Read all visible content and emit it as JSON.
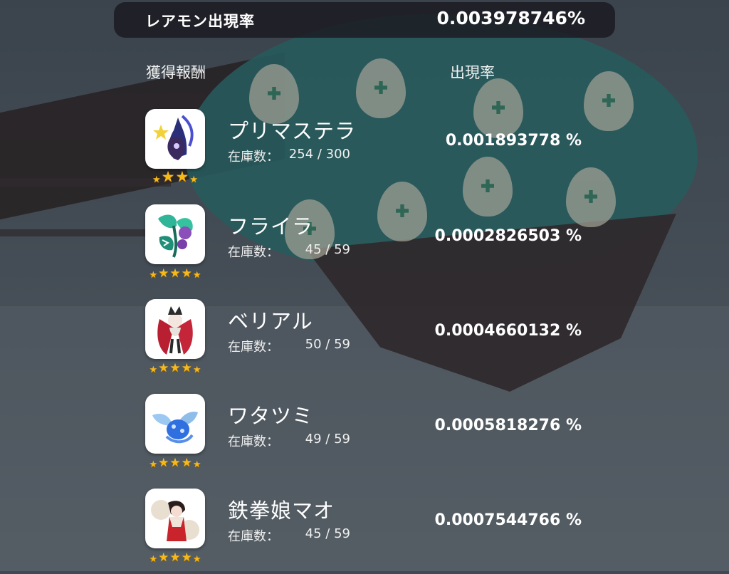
{
  "header": {
    "title": "レアモン出現率",
    "rate": "0.003978746%"
  },
  "columns": {
    "reward": "獲得報酬",
    "rate": "出現率"
  },
  "rewards": [
    {
      "name": "プリマステラ",
      "stock_label": "在庫数：",
      "stock": "254 / 300",
      "rate": "0.001893778 %",
      "stars": 3
    },
    {
      "name": "フライラ",
      "stock_label": "在庫数：",
      "stock": "45 / 59",
      "rate": "0.0002826503 %",
      "stars": 4
    },
    {
      "name": "ベリアル",
      "stock_label": "在庫数：",
      "stock": "50 / 59",
      "rate": "0.0004660132 %",
      "stars": 4
    },
    {
      "name": "ワタツミ",
      "stock_label": "在庫数：",
      "stock": "49 / 59",
      "rate": "0.0005818276 %",
      "stars": 4
    },
    {
      "name": "鉄拳娘マオ",
      "stock_label": "在庫数：",
      "stock": "45 / 59",
      "rate": "0.0007544766 %",
      "stars": 4
    }
  ],
  "colors": {
    "star": "#f7b81c",
    "header_bg": "#1c1c22",
    "card_bg": "#ffffff"
  }
}
